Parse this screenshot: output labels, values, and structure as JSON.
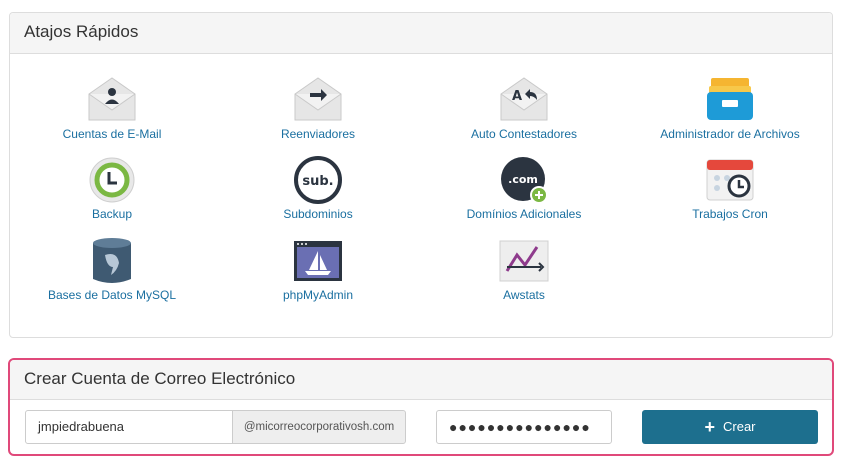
{
  "shortcuts": {
    "title": "Atajos Rápidos",
    "items": [
      {
        "label": "Cuentas de E-Mail",
        "icon": "email-accounts-icon"
      },
      {
        "label": "Reenviadores",
        "icon": "forwarders-icon"
      },
      {
        "label": "Auto Contestadores",
        "icon": "autoresponders-icon"
      },
      {
        "label": "Administrador de Archivos",
        "icon": "file-manager-icon"
      },
      {
        "label": "Backup",
        "icon": "backup-icon"
      },
      {
        "label": "Subdominios",
        "icon": "subdomains-icon"
      },
      {
        "label": "Domínios Adicionales",
        "icon": "addon-domains-icon"
      },
      {
        "label": "Trabajos Cron",
        "icon": "cron-jobs-icon"
      },
      {
        "label": "Bases de Datos MySQL",
        "icon": "mysql-icon"
      },
      {
        "label": "phpMyAdmin",
        "icon": "phpmyadmin-icon"
      },
      {
        "label": "Awstats",
        "icon": "awstats-icon"
      }
    ],
    "subdomain_text": "sub.",
    "addon_text": ".com"
  },
  "create_email": {
    "title": "Crear Cuenta de Correo Electrónico",
    "username": "jmpiedrabuena",
    "domain": "@micorreocorporativosh.com",
    "password_mask": "●●●●●●●●●●●●●●●",
    "button_label": "Crear"
  },
  "colors": {
    "link": "#1a6fa0",
    "button": "#1d6f8e",
    "highlight_border": "#e0497a"
  }
}
